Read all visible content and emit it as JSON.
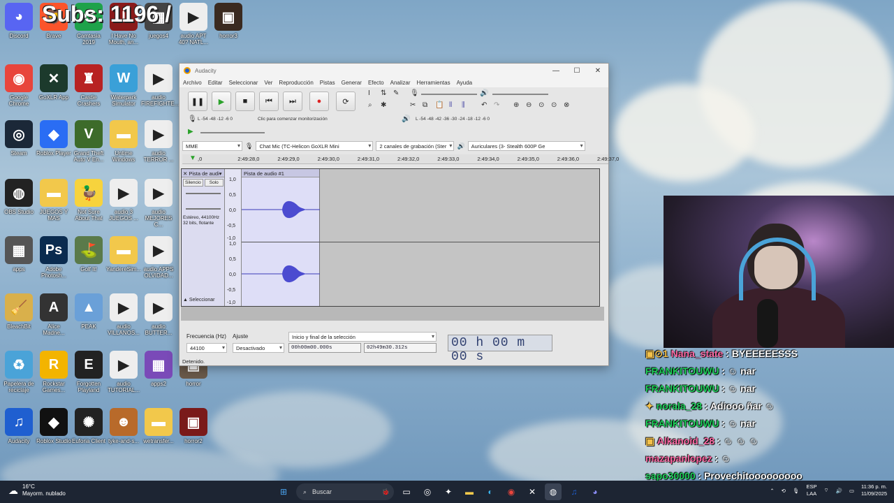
{
  "overlay": {
    "subs_text": "Subs: 1196 /"
  },
  "desktop_icons": [
    {
      "label": "Discord",
      "color": "#5865f2",
      "glyph": "◕"
    },
    {
      "label": "Brave",
      "color": "#fb542b",
      "glyph": "🦁"
    },
    {
      "label": "Camtasia 2019",
      "color": "#1ea24a",
      "glyph": "C"
    },
    {
      "label": "I Have No Mouth, an...",
      "color": "#8a1a1a",
      "glyph": "I"
    },
    {
      "label": "juegos4",
      "color": "#444",
      "glyph": "▦"
    },
    {
      "label": "audio APT 40? NATL...",
      "color": "#eee",
      "glyph": "▶"
    },
    {
      "label": "horror3",
      "color": "#3a2a20",
      "glyph": "▣"
    },
    {
      "label": "Google Chrome",
      "color": "#e8453c",
      "glyph": "◉"
    },
    {
      "label": "GoXLR App",
      "color": "#1c3a2c",
      "glyph": "✕"
    },
    {
      "label": "Castle Crashers",
      "color": "#b82222",
      "glyph": "♜"
    },
    {
      "label": "Waterpark Simulator",
      "color": "#3aa0d8",
      "glyph": "W"
    },
    {
      "label": "audio FIREFIGHTE...",
      "color": "#eee",
      "glyph": "▶"
    },
    {
      "label": "Steam",
      "color": "#1b2838",
      "glyph": "◎"
    },
    {
      "label": "Roblox Player",
      "color": "#2a6df4",
      "glyph": "◆"
    },
    {
      "label": "Grand Theft Auto V En...",
      "color": "#3d6b2a",
      "glyph": "V"
    },
    {
      "label": "Untime Windows",
      "color": "#f2c84b",
      "glyph": "▬"
    },
    {
      "label": "audio TERROR ...",
      "color": "#eee",
      "glyph": "▶"
    },
    {
      "label": "OBS Studio",
      "color": "#222",
      "glyph": "◍"
    },
    {
      "label": "JUEGOS Y MAS",
      "color": "#f2c84b",
      "glyph": "▬"
    },
    {
      "label": "Not Sure About That",
      "color": "#f7d33d",
      "glyph": "🦆"
    },
    {
      "label": "audio 3 JUEGOS ...",
      "color": "#eee",
      "glyph": "▶"
    },
    {
      "label": "audio MEJORES C...",
      "color": "#eee",
      "glyph": "▶"
    },
    {
      "label": "apps",
      "color": "#555",
      "glyph": "▦"
    },
    {
      "label": "Adobe Photosh...",
      "color": "#0a2b4f",
      "glyph": "Ps"
    },
    {
      "label": "Golf It!",
      "color": "#5a7a4a",
      "glyph": "⛳"
    },
    {
      "label": "YandereSim...",
      "color": "#f2c84b",
      "glyph": "▬"
    },
    {
      "label": "audio APPS OLVIDAD...",
      "color": "#eee",
      "glyph": "▶"
    },
    {
      "label": "BleachBit",
      "color": "#d9b04b",
      "glyph": "🧹"
    },
    {
      "label": "Alice Madne...",
      "color": "#333",
      "glyph": "A"
    },
    {
      "label": "PEAK",
      "color": "#6aa0d8",
      "glyph": "▲"
    },
    {
      "label": "audio VILLANOS...",
      "color": "#eee",
      "glyph": "▶"
    },
    {
      "label": "audio BUTTER...",
      "color": "#eee",
      "glyph": "▶"
    },
    {
      "label": "Papelera de reciclaje",
      "color": "#4aa3d8",
      "glyph": "♻"
    },
    {
      "label": "Rockstar Games...",
      "color": "#f3b400",
      "glyph": "R"
    },
    {
      "label": "Forgotten Playland",
      "color": "#222",
      "glyph": "E"
    },
    {
      "label": "audio TUTORIAL...",
      "color": "#eee",
      "glyph": "▶"
    },
    {
      "label": "apps2",
      "color": "#7a4ab8",
      "glyph": "▦"
    },
    {
      "label": "horror",
      "color": "#6a5a4a",
      "glyph": "▣"
    },
    {
      "label": "Audacity",
      "color": "#1f5fd0",
      "glyph": "♫"
    },
    {
      "label": "Roblox Studio",
      "color": "#111",
      "glyph": "◆"
    },
    {
      "label": "Euforia Client",
      "color": "#222",
      "glyph": "✺"
    },
    {
      "label": "tyke-and-s...",
      "color": "#b86a2a",
      "glyph": "☻"
    },
    {
      "label": "wetransfer...",
      "color": "#f2c84b",
      "glyph": "▬"
    },
    {
      "label": "horror2",
      "color": "#7a1a1a",
      "glyph": "▣"
    }
  ],
  "audacity": {
    "title": "Audacity",
    "menu": [
      "Archivo",
      "Editar",
      "Seleccionar",
      "Ver",
      "Reproducción",
      "Pistas",
      "Generar",
      "Efecto",
      "Analizar",
      "Herramientas",
      "Ayuda"
    ],
    "meter_record_hint": "Clic para comenzar monitorización",
    "meter_record_scale": [
      "-54",
      "-48",
      "-12",
      "-6",
      "0"
    ],
    "meter_play_scale": [
      "-54",
      "-48",
      "-42",
      "-36",
      "-30",
      "-24",
      "-18",
      "-12",
      "-6",
      "0"
    ],
    "host": "MME",
    "record_device": "Chat Mic (TC-Helicon GoXLR Mini",
    "channels": "2 canales de grabación (Ster",
    "playback_device": "Auriculares (3- Stealth 600P Ge",
    "ruler_ticks": [
      ",0",
      "2:49:28,0",
      "2:49:29,0",
      "2:49:30,0",
      "2:49:31,0",
      "2:49:32,0",
      "2:49:33,0",
      "2:49:34,0",
      "2:49:35,0",
      "2:49:36,0",
      "2:49:37,0"
    ],
    "track": {
      "name": "Pista de audi▾",
      "mute": "Silencio",
      "solo": "Solo",
      "info": "Estéreo, 44100Hz 32 bits, flotante",
      "select": "Seleccionar",
      "clip_name": "Pista de audio #1",
      "scale": [
        "1,0",
        "0,5",
        "0,0",
        "-0,5",
        "-1,0",
        "1,0",
        "0,5",
        "0,0",
        "-0,5",
        "-1,0"
      ]
    },
    "selection": {
      "rate_label": "Frecuencia (Hz)",
      "rate_value": "44100",
      "snap_label": "Ajuste",
      "snap_value": "Desactivado",
      "range_label": "Inicio y final de la selección",
      "start": "00h00m00.000s",
      "end": "02h49m30.312s",
      "big_time": "00 h 00 m 00 s"
    },
    "status": "Detenido."
  },
  "chat": [
    {
      "user": "Nana_state",
      "msg": ": BYEEEEESSS",
      "badge": "▣⊙1"
    },
    {
      "user": "FRANKITOUWU",
      "msg": ": ☺ nar",
      "badge": ""
    },
    {
      "user": "FRANKITOUWU",
      "msg": ": ☺ nar",
      "badge": ""
    },
    {
      "user": "norala_28",
      "msg": ": Adiooo ñar ☺",
      "badge": "✦"
    },
    {
      "user": "FRANKITOUWU",
      "msg": ": ☺ nar",
      "badge": ""
    },
    {
      "user": "Alkanoid_28",
      "msg": ": ☺ ☺ ☺",
      "badge": "▣"
    },
    {
      "user": "mazapanlopez",
      "msg": ": ☺",
      "badge": ""
    },
    {
      "user": "sapo30000",
      "msg": ": Provechitooooooooo",
      "badge": ""
    }
  ],
  "taskbar": {
    "temp": "16°C",
    "weather": "Mayorm. nublado",
    "search": "Buscar",
    "lang": "ESP",
    "lang2": "LAA",
    "time": "11:36 p. m.",
    "date": "11/09/2025"
  }
}
